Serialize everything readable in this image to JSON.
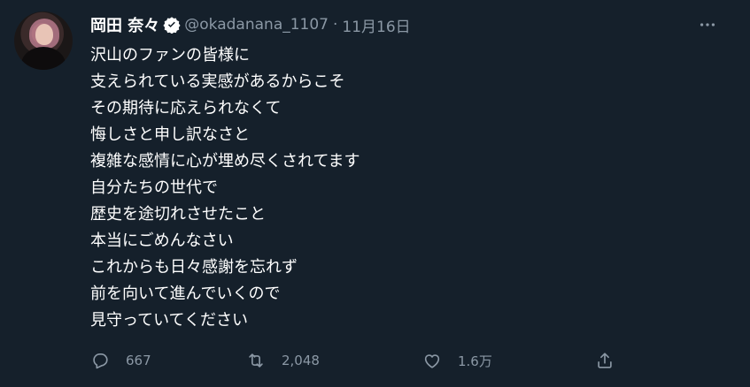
{
  "tweet": {
    "author_name": "岡田 奈々",
    "handle": "@okadanana_1107",
    "separator": "·",
    "date": "11月16日",
    "lines": [
      "沢山のファンの皆様に",
      "支えられている実感があるからこそ",
      "その期待に応えられなくて",
      "悔しさと申し訳なさと",
      "複雑な感情に心が埋め尽くされてます",
      "自分たちの世代で",
      "歴史を途切れさせたこと",
      "本当にごめんなさい",
      "これからも日々感謝を忘れず",
      "前を向いて進んでいくので",
      "見守っていてください"
    ],
    "stats": {
      "replies": "667",
      "retweets": "2,048",
      "likes": "1.6万"
    }
  },
  "icons": {
    "verified": "verified-badge-icon",
    "more": "more-dots-icon",
    "reply": "reply-icon",
    "retweet": "retweet-icon",
    "like": "heart-icon",
    "share": "share-icon"
  },
  "colors": {
    "background": "#15202b",
    "text_primary": "#ffffff",
    "text_secondary": "#8b98a5"
  }
}
